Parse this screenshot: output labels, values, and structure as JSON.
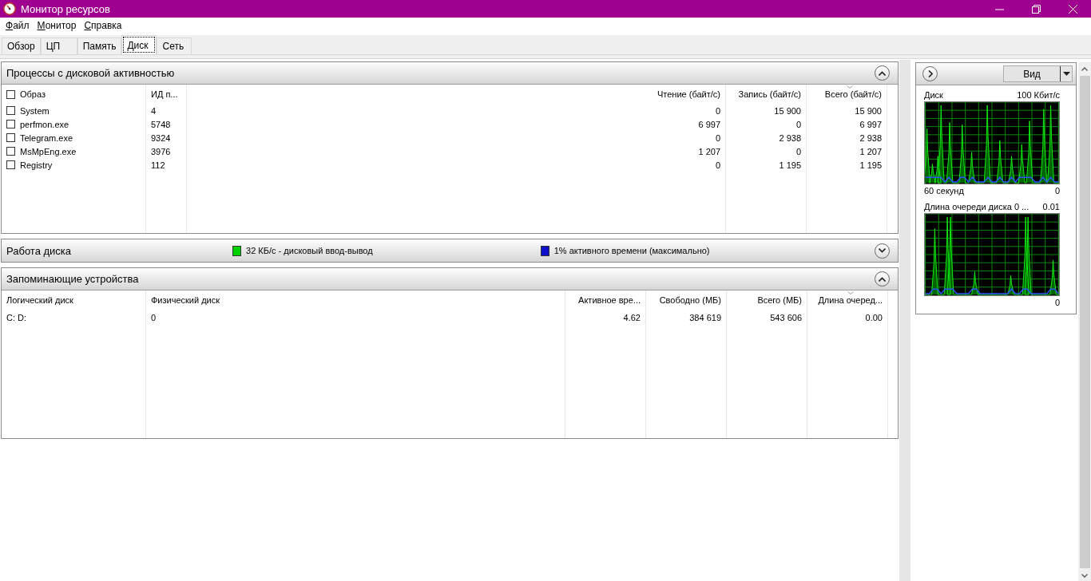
{
  "window": {
    "title": "Монитор ресурсов"
  },
  "menu": [
    {
      "label": "Файл"
    },
    {
      "label": "Монитор"
    },
    {
      "label": "Справка"
    }
  ],
  "tabs": [
    {
      "label": "Обзор",
      "selected": false
    },
    {
      "label": "ЦП",
      "selected": false
    },
    {
      "label": "Память",
      "selected": false
    },
    {
      "label": "Диск",
      "selected": true
    },
    {
      "label": "Сеть",
      "selected": false
    }
  ],
  "processes": {
    "title": "Процессы с дисковой активностью",
    "expanded": true,
    "columns": [
      {
        "label": "Образ",
        "sorted": false
      },
      {
        "label": "ИД п...",
        "sorted": false
      },
      {
        "label": "Чтение (байт/с)",
        "sorted": false
      },
      {
        "label": "Запись (байт/с)",
        "sorted": false
      },
      {
        "label": "Всего (байт/с)",
        "sorted": true
      }
    ],
    "all_checked": false,
    "rows": [
      {
        "checked": false,
        "cells": [
          "System",
          "4",
          "0",
          "15 900",
          "15 900"
        ]
      },
      {
        "checked": false,
        "cells": [
          "perfmon.exe",
          "5748",
          "6 997",
          "0",
          "6 997"
        ]
      },
      {
        "checked": false,
        "cells": [
          "Telegram.exe",
          "9324",
          "0",
          "2 938",
          "2 938"
        ]
      },
      {
        "checked": false,
        "cells": [
          "MsMpEng.exe",
          "3976",
          "1 207",
          "0",
          "1 207"
        ]
      },
      {
        "checked": false,
        "cells": [
          "Registry",
          "112",
          "0",
          "1 195",
          "1 195"
        ]
      }
    ]
  },
  "disk_activity": {
    "title": "Работа диска",
    "expanded": false,
    "legend": [
      {
        "text": "32 КБ/с - дисковый ввод-вывод",
        "color": "#00d000"
      },
      {
        "text": "1% активного времени (максимально)",
        "color": "#1010c8"
      }
    ]
  },
  "storage": {
    "title": "Запоминающие устройства",
    "expanded": true,
    "columns": [
      {
        "label": "Логический диск",
        "sorted": false
      },
      {
        "label": "Физический диск",
        "sorted": false
      },
      {
        "label": "Активное вре...",
        "sorted": false
      },
      {
        "label": "Свободно (МБ)",
        "sorted": false
      },
      {
        "label": "Всего (МБ)",
        "sorted": false
      },
      {
        "label": "Длина очеред...",
        "sorted": true
      }
    ],
    "rows": [
      {
        "cells": [
          "C: D:",
          "0",
          "4.62",
          "384 619",
          "543 606",
          "0.00"
        ]
      }
    ]
  },
  "side": {
    "view_button": "Вид",
    "graphs": [
      {
        "title": "Диск",
        "max": "100 Кбит/с",
        "xlabel": "60 секунд",
        "min": "0"
      },
      {
        "title": "Длина очереди диска 0 ...",
        "max": "0.01",
        "min": "0"
      }
    ]
  }
}
